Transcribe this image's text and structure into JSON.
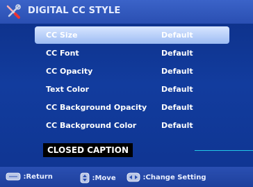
{
  "title": "DIGITAL CC STYLE",
  "menu": [
    {
      "label": "CC Size",
      "value": "Default",
      "selected": true
    },
    {
      "label": "CC Font",
      "value": "Default",
      "selected": false
    },
    {
      "label": "CC Opacity",
      "value": "Default",
      "selected": false
    },
    {
      "label": "Text Color",
      "value": "Default",
      "selected": false
    },
    {
      "label": "CC Background Opacity",
      "value": "Default",
      "selected": false
    },
    {
      "label": "CC Background Color",
      "value": "Default",
      "selected": false
    }
  ],
  "preview": "CLOSED CAPTION",
  "footer": {
    "return_label": ":Return",
    "move_label": ":Move",
    "change_label": ":Change Setting"
  },
  "icons": {
    "title": "tools-icon",
    "return": "menu-button-icon",
    "move": "up-down-button-icon",
    "change": "left-right-button-icon"
  },
  "colors": {
    "background": "#0f3490",
    "title_bar": "#2a4fb2",
    "selected_row": "#9dbcf3",
    "preview_bg": "#000000",
    "divider": "#22c7e8"
  }
}
